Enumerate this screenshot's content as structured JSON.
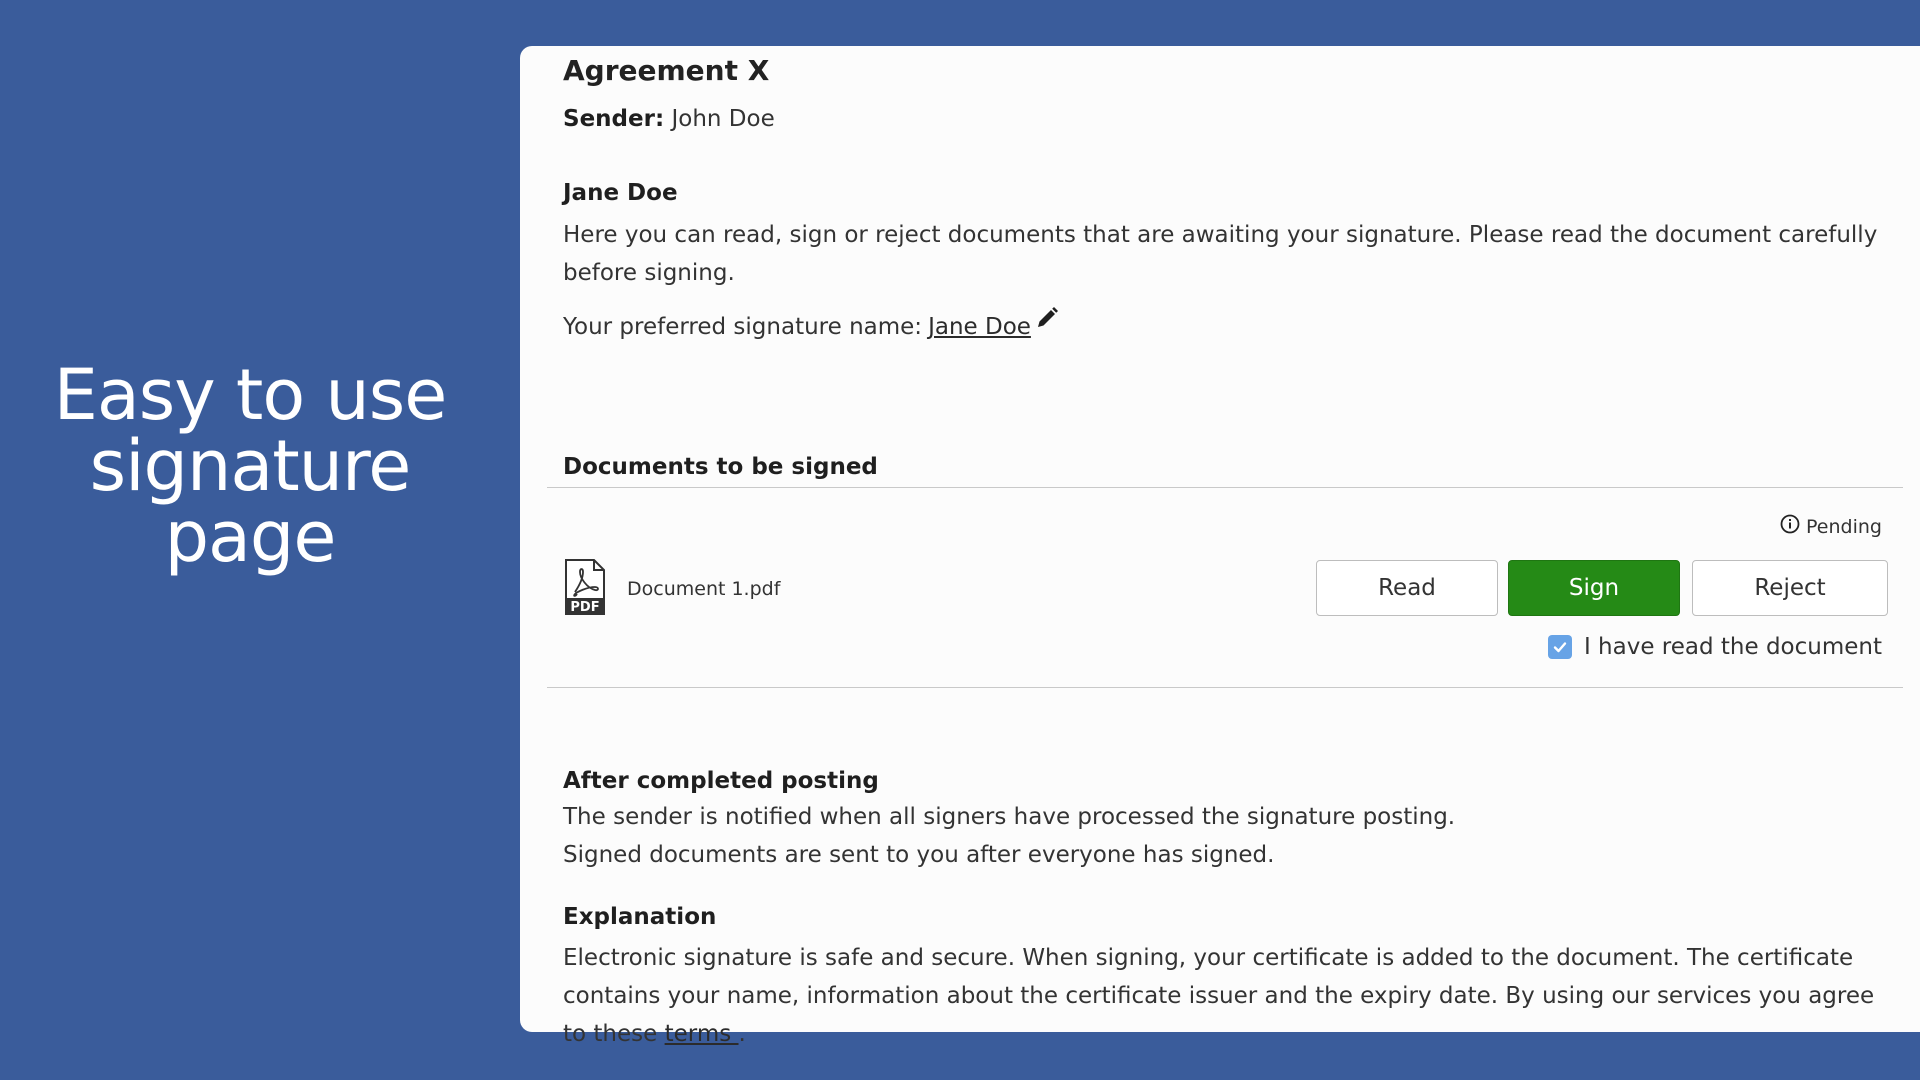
{
  "hero": {
    "line1": "Easy to use",
    "line2": "signature",
    "line3": "page"
  },
  "agreement": {
    "title": "Agreement X",
    "sender_label": "Sender:",
    "sender_name": "John Doe"
  },
  "signer": {
    "name": "Jane Doe",
    "intro": "Here you can read, sign or reject documents that are awaiting your signature. Please read the document carefully before signing.",
    "preferred_label": "Your preferred signature name:",
    "preferred_name": "Jane Doe"
  },
  "documents": {
    "heading": "Documents to be signed",
    "status": "Pending",
    "items": [
      {
        "file_name": "Document 1.pdf",
        "icon_text": "PDF",
        "read_label": "Read",
        "sign_label": "Sign",
        "reject_label": "Reject",
        "read_confirm_label": "I have read the document",
        "read_confirmed": true
      }
    ]
  },
  "after": {
    "heading": "After completed posting",
    "line1": "The sender is notified when all signers have processed the signature posting.",
    "line2": "Signed documents are sent to you after everyone has signed."
  },
  "explanation": {
    "heading": "Explanation",
    "text": "Electronic signature is safe and secure. When signing, your certificate is added to the document. The certificate contains your name, information about the certificate issuer and the expiry date. By using our services you agree to these",
    "link_text": "terms ",
    "end": "."
  },
  "colors": {
    "background": "#3a5c9b",
    "card": "#fcfcfc",
    "sign_button": "#258a16",
    "checkbox": "#67a3e6"
  }
}
